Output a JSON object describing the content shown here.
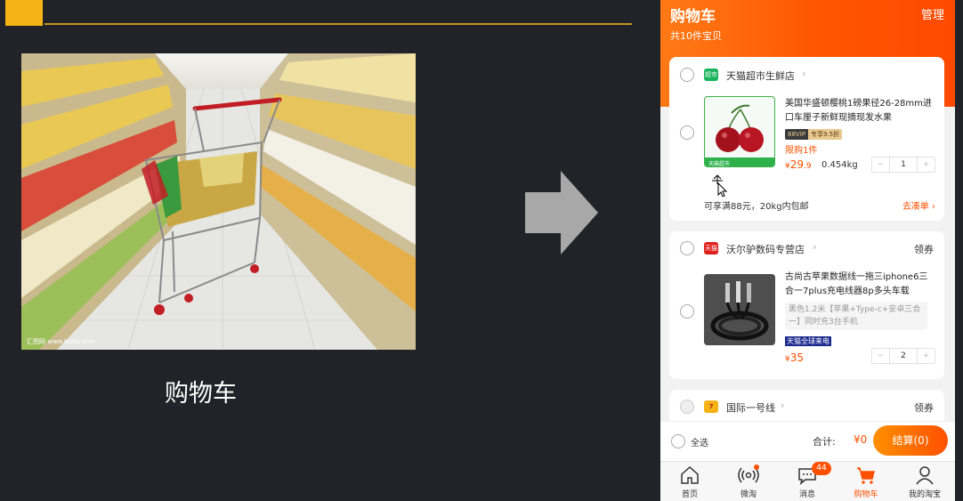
{
  "slide": {
    "caption": "购物车",
    "photo_watermark": "汇图网 www.huitu.com"
  },
  "phone": {
    "header": {
      "title": "购物车",
      "manage": "管理",
      "count": "共10件宝贝"
    },
    "stores": [
      {
        "badge": "超市",
        "badge_color": "#18b35a",
        "name": "天猫超市生鲜店",
        "chevron": "›",
        "product": {
          "title": "美国华盛顿樱桃1磅果径26-28mm进口车厘子新鲜现摘现发水果",
          "vip_tag": "88VIP",
          "vip_discount": "专享9.5折",
          "limit": "限购1件",
          "price_symbol": "¥",
          "price_int": "29",
          "price_dec": ".9",
          "weight": "0.454kg",
          "qty": "1",
          "img_label": "天猫超市"
        },
        "promo": "可享满88元，20kg内包邮",
        "promo_link": "去凑单 ›"
      },
      {
        "badge": "天猫",
        "badge_color": "#e0201c",
        "name": "沃尔驴数码专营店",
        "chevron": "›",
        "coupon": "领券",
        "product": {
          "title": "古尚古苹果数据线一拖三iphone6三合一7plus充电线器8p多头车载",
          "sku": "黑色1.2米【苹果+Type-c+安卓三合一】同时充3台手机",
          "tag": "天猫全球来电",
          "price_symbol": "¥",
          "price_int": "35",
          "qty": "2"
        }
      },
      {
        "badge": "7",
        "badge_color": "#f5b315",
        "name": "国际一号线",
        "chevron": "›",
        "coupon": "领券"
      }
    ],
    "bottom": {
      "select_all": "全选",
      "total_label": "合计:",
      "total_value": "¥0",
      "checkout": "结算(0)"
    },
    "tabs": [
      {
        "label": "首页",
        "icon": "home-icon"
      },
      {
        "label": "微淘",
        "icon": "broadcast-icon"
      },
      {
        "label": "消息",
        "icon": "message-icon",
        "badge": "44"
      },
      {
        "label": "购物车",
        "icon": "cart-icon",
        "active": true
      },
      {
        "label": "我的淘宝",
        "icon": "user-icon"
      }
    ],
    "accent": "#ff5000"
  }
}
